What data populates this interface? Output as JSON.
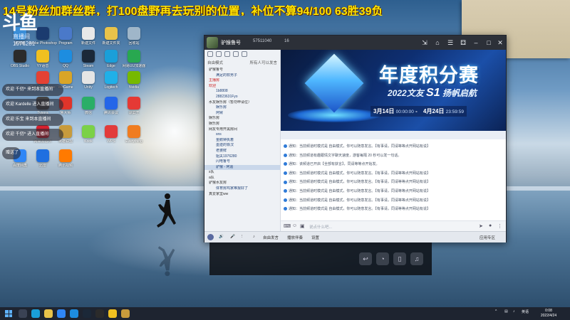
{
  "overlay": {
    "top_notice": "14号粉丝加群丝群，打100盘野再去玩别的位置，补位不算94/100 63胜39负",
    "logo_text": "斗鱼",
    "room_text": "直播间 1576281"
  },
  "desktop": {
    "icons": [
      {
        "label": "此电脑",
        "color": "#3a8ed8"
      },
      {
        "label": "Adobe Photoshop",
        "color": "#1b3b6f"
      },
      {
        "label": "Program",
        "color": "#4a79c9"
      },
      {
        "label": "新建文件",
        "color": "#e8e8e8"
      },
      {
        "label": "新建文件夹",
        "color": "#e8c24a"
      },
      {
        "label": "回收站",
        "color": "#9fb6c9"
      },
      {
        "label": "OBS Studio",
        "color": "#2b2b2b"
      },
      {
        "label": "YY语音",
        "color": "#f0c020"
      },
      {
        "label": "QQ",
        "color": "#1d8de0"
      },
      {
        "label": "Steam",
        "color": "#1b2838"
      },
      {
        "label": "Edge",
        "color": "#1a9fd9"
      },
      {
        "label": "网易UU加速器",
        "color": "#28a850"
      },
      {
        "label": "Google Chrome",
        "color": "#e44134"
      },
      {
        "label": "WeGame",
        "color": "#d9a527"
      },
      {
        "label": "Unity",
        "color": "#e5e5e5"
      },
      {
        "label": "Logitech",
        "color": "#20b0e8"
      },
      {
        "label": "Nvidia",
        "color": "#76b900"
      },
      {
        "label": "Typora",
        "color": "#444"
      },
      {
        "label": "鲁大师",
        "color": "#e0342a"
      },
      {
        "label": "微信",
        "color": "#2aae67"
      },
      {
        "label": "腾讯会议",
        "color": "#2466e8"
      },
      {
        "label": "录屏王",
        "color": "#e53935"
      },
      {
        "label": "网易云音乐",
        "color": "#d6202e"
      },
      {
        "label": "英雄联盟",
        "color": "#c89b3c"
      },
      {
        "label": "Kook",
        "color": "#7bd148"
      },
      {
        "label": "WPS",
        "color": "#e23b3b"
      },
      {
        "label": "Everything",
        "color": "#f07c1f"
      },
      {
        "label": "百度网盘",
        "color": "#2f86f6"
      },
      {
        "label": "迅雷",
        "color": "#1f6fe0"
      },
      {
        "label": "腾讯视频",
        "color": "#ff7a00"
      }
    ],
    "chat_bubbles": [
      "欢迎 千仞^ 来到本直播间",
      "欢迎 Kardelle 进入直播间",
      "欢迎 乐宝 来到本直播间",
      "欢迎 千仞^ 进入直播间",
      "赠送了"
    ]
  },
  "app": {
    "title": {
      "username": "驴猴鲁号",
      "id": "57511040",
      "online": "16"
    },
    "sidebar": {
      "mode_label": "自由模式",
      "mode_hint": "所有人可以发言",
      "rows": [
        {
          "text": "驴猴鲁号",
          "type": "channel"
        },
        {
          "text": "满足的软男子",
          "type": "user"
        },
        {
          "text": "主播房",
          "type": "channel red"
        },
        {
          "text": "欢迎",
          "type": "channel red"
        },
        {
          "text": "1b8808",
          "type": "user"
        },
        {
          "text": "28823631Fyo",
          "type": "user"
        },
        {
          "text": "水友娱乐房（暂勿申请位）",
          "type": "channel"
        },
        {
          "text": "娱乐房",
          "type": "user"
        },
        {
          "text": "阿臂",
          "type": "user"
        },
        {
          "text": "娱乐房",
          "type": "channel"
        },
        {
          "text": "娱乐房",
          "type": "channel"
        },
        {
          "text": "网友专用开黑房间",
          "type": "channel"
        },
        {
          "text": "sns",
          "type": "user"
        },
        {
          "text": "金鹅钟执着",
          "type": "user"
        },
        {
          "text": "墨迹的铁汉",
          "type": "user"
        },
        {
          "text": "老婆鲜",
          "type": "user"
        },
        {
          "text": "姐夫1976280",
          "type": "user"
        },
        {
          "text": "闪电鲁号",
          "type": "user"
        },
        {
          "text": "驴猴 - 阿嘉",
          "type": "user sel"
        },
        {
          "text": "s队",
          "type": "channel"
        },
        {
          "text": "a队",
          "type": "channel"
        },
        {
          "text": "驴猴水友房",
          "type": "channel"
        },
        {
          "text": "体育房鸡家难报好了",
          "type": "user"
        },
        {
          "text": "真爱家里ww",
          "type": "channel"
        }
      ]
    },
    "banner": {
      "title": "年度积分赛",
      "subtitle_prefix": "2022文友",
      "subtitle_s1": "S1",
      "subtitle_suffix": "扬帆启航",
      "start_date": "3月14日",
      "start_time": "00:00:00",
      "sep": "-",
      "end_date": "4月24日",
      "end_time": "23:59:59"
    },
    "messages": [
      "通知：当前频道时模式是 自由模式，你可以随意发言。【有事请，同请等等点开网站有说】",
      "通知：当前频道有趣跟情文字聊天速度，游客每隔 20 秒可以发一句话。",
      "通知：该频道已开启【全部有获言】，同请等等点开始发。",
      "通知：当前频道时模式是 自由模式，你可以随意发言。【有事请，同请等等点开网站有说】",
      "通知：当前频道时模式是 自由模式，你可以随意发言。【有事请，同请等等点开网站有说】",
      "通知：当前频道时模式是 自由模式，你可以随意发言。【有事请，同请等等点开网站有说】",
      "通知：当前频道时模式是 自由模式，你可以随意发言。【有事请，同请等等点开网站有说】",
      "通知：当前频道时模式是 自由模式，你可以随意发言。【有事请，同请等等点开网站有说】"
    ],
    "input_placeholder": "说点什么吧...",
    "bottom": {
      "free_mode": "自由发言",
      "play_music": "播放伴奏",
      "settings": "设置",
      "apply": "应用专区"
    }
  },
  "taskbar": {
    "tray_text": "中",
    "lang": "英语",
    "time": "0:08",
    "date": "2022/4/24"
  }
}
